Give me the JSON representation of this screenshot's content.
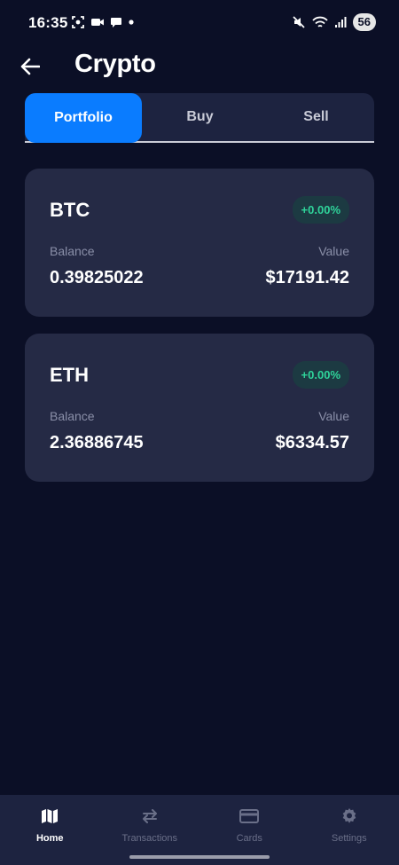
{
  "status_bar": {
    "time": "16:35",
    "battery": "56",
    "icons": [
      "screenshot-icon",
      "video-icon",
      "chat-icon",
      "dot-icon",
      "mute-icon",
      "wifi-icon",
      "signal-icon"
    ]
  },
  "header": {
    "title": "Crypto",
    "back_icon": "arrow-left-icon"
  },
  "tabs": [
    {
      "label": "Portfolio",
      "active": true
    },
    {
      "label": "Buy",
      "active": false
    },
    {
      "label": "Sell",
      "active": false
    }
  ],
  "holdings": [
    {
      "symbol": "BTC",
      "change": "+0.00%",
      "balance_label": "Balance",
      "balance": "0.39825022",
      "value_label": "Value",
      "value": "$17191.42"
    },
    {
      "symbol": "ETH",
      "change": "+0.00%",
      "balance_label": "Balance",
      "balance": "2.36886745",
      "value_label": "Value",
      "value": "$6334.57"
    }
  ],
  "bottom_nav": [
    {
      "label": "Home",
      "icon": "map-icon",
      "active": true
    },
    {
      "label": "Transactions",
      "icon": "swap-arrows-icon",
      "active": false
    },
    {
      "label": "Cards",
      "icon": "card-icon",
      "active": false
    },
    {
      "label": "Settings",
      "icon": "gear-icon",
      "active": false
    }
  ],
  "colors": {
    "background": "#0b0f26",
    "surface": "#252a45",
    "accent": "#0a7cff",
    "positive": "#2fd39a",
    "muted": "#8a8fa8"
  }
}
